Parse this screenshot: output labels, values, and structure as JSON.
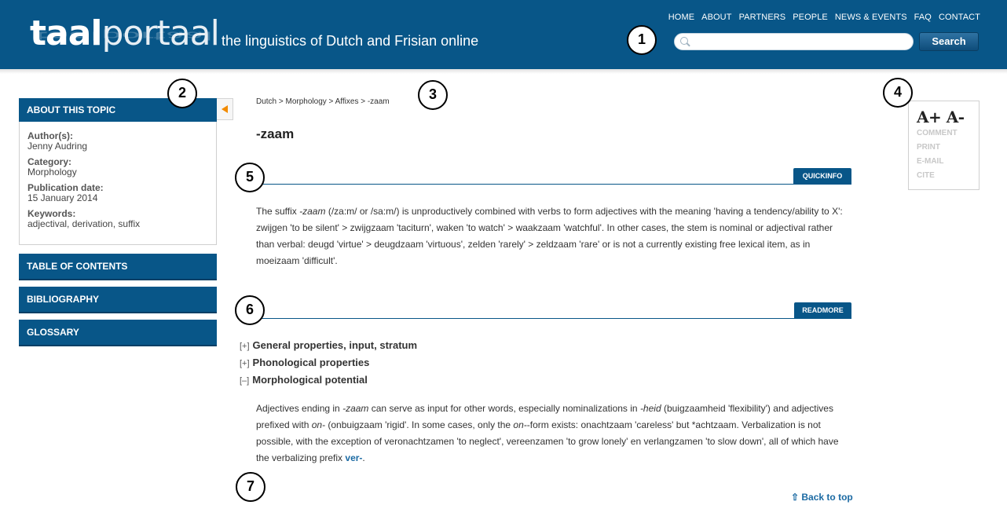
{
  "header": {
    "logo_bold": "taal",
    "logo_light": "portaal",
    "tagline": "the linguistics of Dutch and Frisian online",
    "nav": [
      "HOME",
      "ABOUT",
      "PARTNERS",
      "PEOPLE",
      "NEWS & EVENTS",
      "FAQ",
      "CONTACT"
    ],
    "search": {
      "value": "",
      "button_label": "Search",
      "icon": "search-icon"
    }
  },
  "markers": [
    "1",
    "2",
    "3",
    "4",
    "5",
    "6",
    "7"
  ],
  "sidebar": {
    "about_title": "ABOUT THIS TOPIC",
    "fields": [
      {
        "label": "Author(s):",
        "value": "Jenny Audring"
      },
      {
        "label": "Category:",
        "value": "Morphology"
      },
      {
        "label": "Publication date:",
        "value": "15 January 2014"
      },
      {
        "label": "Keywords:",
        "value": "adjectival, derivation, suffix"
      }
    ],
    "buttons": [
      "TABLE OF CONTENTS",
      "BIBLIOGRAPHY",
      "GLOSSARY"
    ]
  },
  "breadcrumb": "Dutch > Morphology > Affixes > -zaam",
  "page_title": "-zaam",
  "quickinfo": {
    "tab_label": "QUICKINFO",
    "text_before": "The suffix ",
    "text_italic": "-zaam",
    "text_after": " (/za:m/ or /sa:m/) is unproductively combined with verbs to form adjectives with the meaning 'having a tendency/ability to X': zwijgen  'to be silent' > zwijgzaam  'taciturn', waken  'to watch' > waakzaam  'watchful'. In other cases, the stem is nominal or adjectival rather than verbal: deugd  'virtue' > deugdzaam  'virtuous', zelden  'rarely' > zeldzaam  'rare' or is not a currently existing free lexical item, as in moeizaam  'difficult'."
  },
  "readmore": {
    "tab_label": "READMORE",
    "sections": [
      {
        "toggle": "[+]",
        "title": "General properties, input, stratum"
      },
      {
        "toggle": "[+]",
        "title": "Phonological properties"
      },
      {
        "toggle": "[–]",
        "title": "Morphological potential"
      }
    ],
    "body": {
      "p1": "Adjectives ending in ",
      "i1": "-zaam",
      "p2": " can serve as input for other words, especially nominalizations in ",
      "i2": "-heid",
      "p3": " (buigzaamheid  'flexibility') and adjectives prefixed with ",
      "i3": "on-",
      "p4": " (onbuigzaam  'rigid'. In some cases, only the ",
      "i4": "on-",
      "p5": "-form exists: onachtzaam  'careless' but *achtzaam. Verbalization is not possible, with the exception of veronachtzamen  'to neglect', vereenzamen  'to grow lonely' en verlangzamen  'to slow down', all of which have the verbalizing prefix ",
      "link": "ver-",
      "p6": "."
    }
  },
  "back_to_top": "⇧ Back to top",
  "tools": {
    "font_plus": "A+",
    "font_minus": "A-",
    "links": [
      "COMMENT",
      "PRINT",
      "E-MAIL",
      "CITE"
    ]
  }
}
